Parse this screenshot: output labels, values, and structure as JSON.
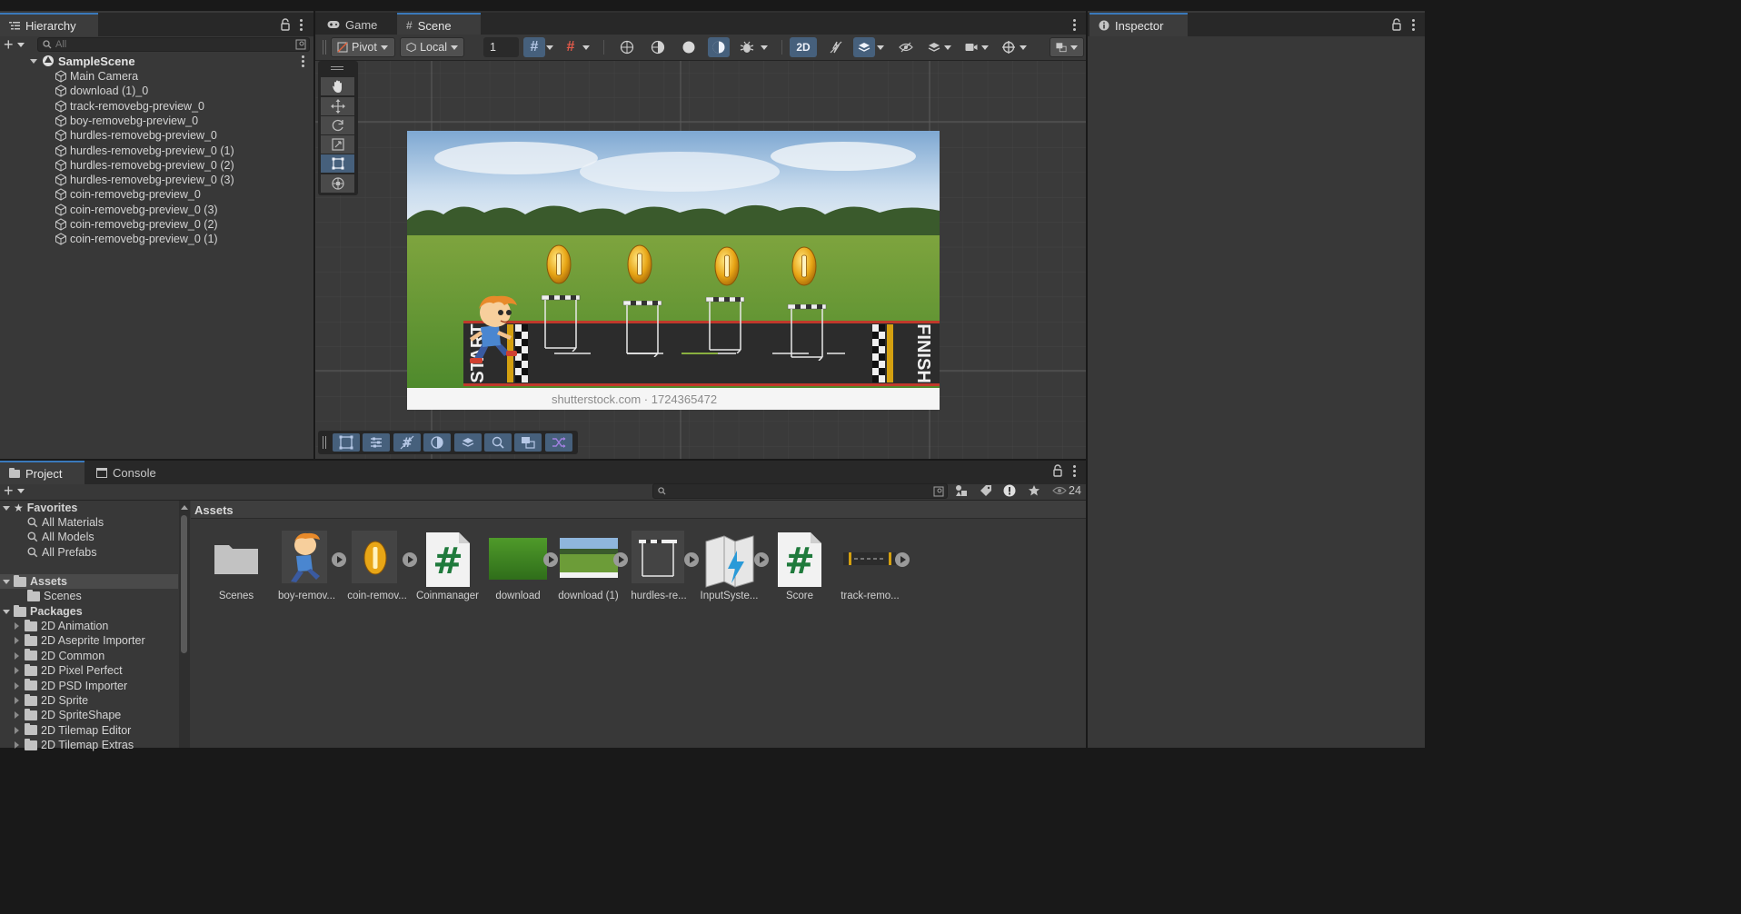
{
  "hierarchy": {
    "tab_label": "Hierarchy",
    "search_placeholder": "All",
    "scene_name": "SampleScene",
    "items": [
      "Main Camera",
      "download (1)_0",
      "track-removebg-preview_0",
      "boy-removebg-preview_0",
      "hurdles-removebg-preview_0",
      "hurdles-removebg-preview_0 (1)",
      "hurdles-removebg-preview_0 (2)",
      "hurdles-removebg-preview_0 (3)",
      "coin-removebg-preview_0",
      "coin-removebg-preview_0 (3)",
      "coin-removebg-preview_0 (2)",
      "coin-removebg-preview_0 (1)"
    ]
  },
  "center_tabs": {
    "game": "Game",
    "scene": "Scene"
  },
  "scene_toolbar": {
    "pivot": "Pivot",
    "local": "Local",
    "grid_increment": "1",
    "mode_2d": "2D"
  },
  "scene_view": {
    "watermark_text": "shutterstock.com · 1724365472"
  },
  "inspector": {
    "tab_label": "Inspector"
  },
  "bottom_tabs": {
    "project": "Project",
    "console": "Console"
  },
  "project": {
    "hidden_count": "24",
    "breadcrumb": "Assets",
    "favorites": {
      "label": "Favorites",
      "items": [
        "All Materials",
        "All Models",
        "All Prefabs"
      ]
    },
    "assets_label": "Assets",
    "assets_children": [
      "Scenes"
    ],
    "packages_label": "Packages",
    "packages": [
      "2D Animation",
      "2D Aseprite Importer",
      "2D Common",
      "2D Pixel Perfect",
      "2D PSD Importer",
      "2D Sprite",
      "2D SpriteShape",
      "2D Tilemap Editor",
      "2D Tilemap Extras"
    ],
    "assets": [
      {
        "name": "Scenes",
        "icon": "folder-icon"
      },
      {
        "name": "boy-remov...",
        "icon": "boy-sprite-icon"
      },
      {
        "name": "coin-remov...",
        "icon": "coin-sprite-icon"
      },
      {
        "name": "Coinmanager",
        "icon": "csharp-script-icon"
      },
      {
        "name": "download",
        "icon": "grass-texture-icon"
      },
      {
        "name": "download (1)",
        "icon": "field-texture-icon"
      },
      {
        "name": "hurdles-re...",
        "icon": "hurdle-sprite-icon"
      },
      {
        "name": "InputSyste...",
        "icon": "input-system-icon"
      },
      {
        "name": "Score",
        "icon": "csharp-script-icon"
      },
      {
        "name": "track-remo...",
        "icon": "track-sprite-icon"
      }
    ]
  },
  "colors": {
    "accent_blue": "#3a79bb",
    "panel_bg": "#383838",
    "tab_bar_bg": "#282828",
    "selected_tool": "#46607c"
  }
}
